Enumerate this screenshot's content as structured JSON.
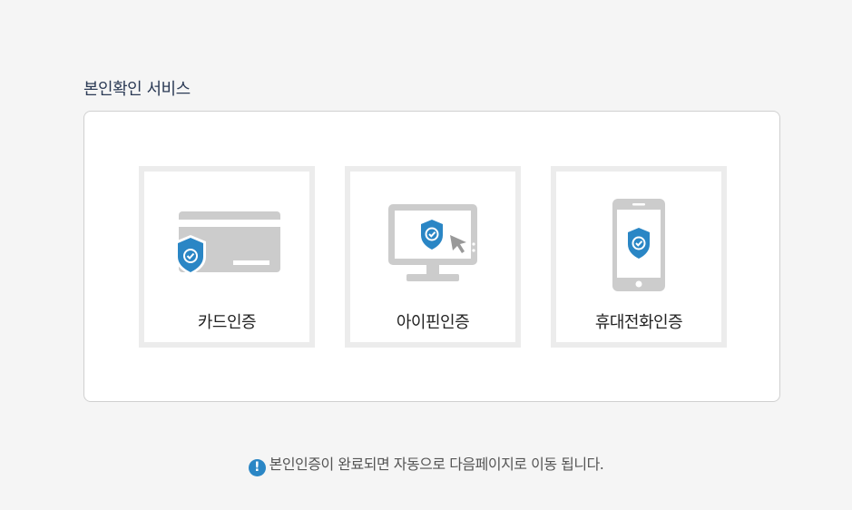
{
  "header": {
    "title": "본인확인 서비스"
  },
  "cards": [
    {
      "label": "카드인증",
      "icon": "card-shield-icon"
    },
    {
      "label": "아이핀인증",
      "icon": "monitor-shield-icon"
    },
    {
      "label": "휴대전화인증",
      "icon": "phone-shield-icon"
    }
  ],
  "notice": {
    "text": "본인인증이 완료되면 자동으로 다음페이지로 이동 됩니다.",
    "icon": "exclamation-icon"
  },
  "colors": {
    "accent": "#2a86c5",
    "icon_gray": "#cccccc",
    "card_border": "#ececec",
    "title": "#2b3a55"
  }
}
